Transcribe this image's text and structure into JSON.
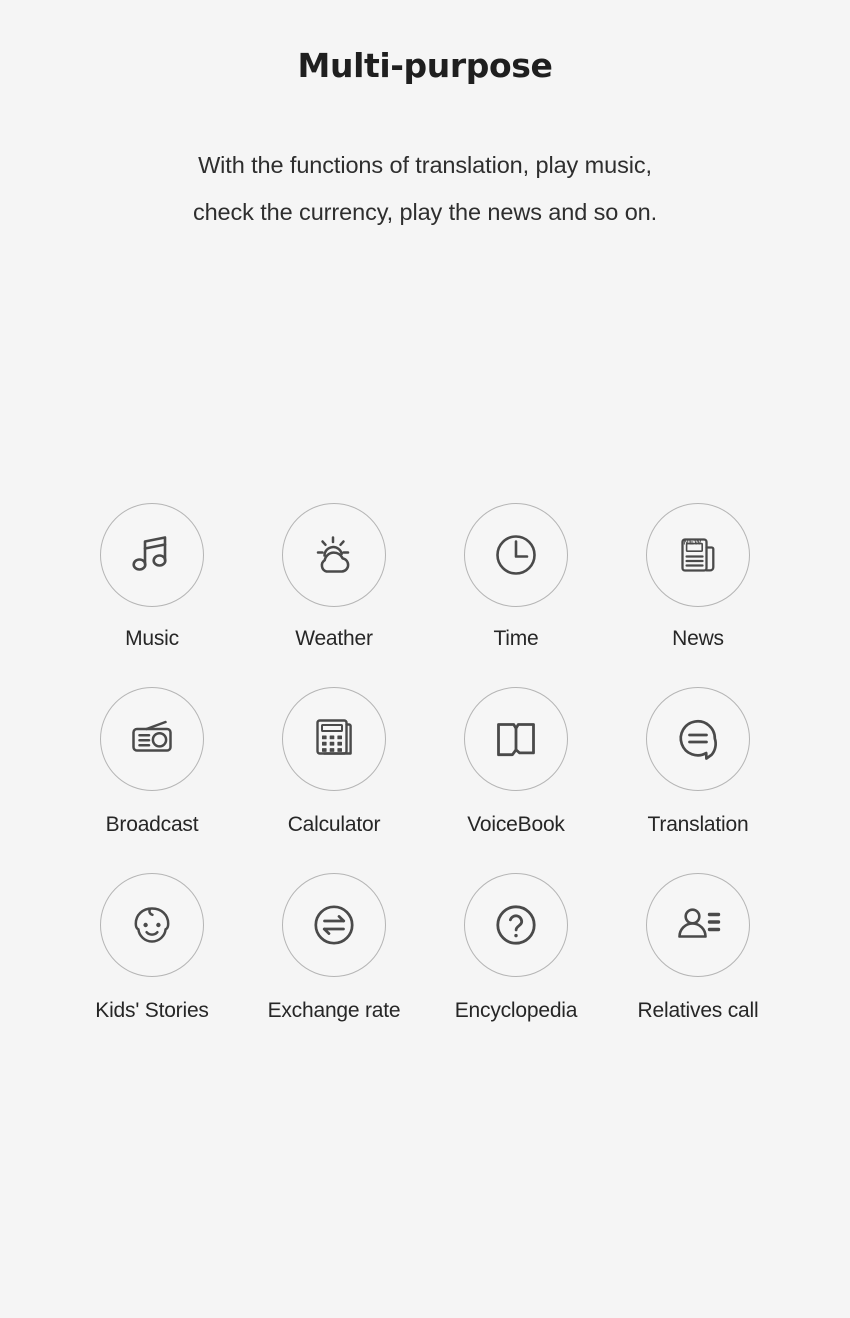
{
  "header": {
    "title": "Multi-purpose",
    "subtitle_lines": [
      "With the functions of translation, play music,",
      "check the currency, play the news and so on."
    ]
  },
  "theme": {
    "background_color": "#f5f5f5",
    "text_color": "#262626",
    "icon_stroke_color": "#4a4a4a",
    "circle_border_color": "#b5b5b5"
  },
  "features": {
    "rows": [
      {
        "items": [
          {
            "label": "Music",
            "icon": "music-note-icon"
          },
          {
            "label": "Weather",
            "icon": "sun-cloud-icon"
          },
          {
            "label": "Time",
            "icon": "clock-icon"
          },
          {
            "label": "News",
            "icon": "newspaper-icon",
            "icon_text": "NEW"
          }
        ]
      },
      {
        "items": [
          {
            "label": "Broadcast",
            "icon": "radio-icon"
          },
          {
            "label": "Calculator",
            "icon": "calculator-icon"
          },
          {
            "label": "VoiceBook",
            "icon": "open-book-icon"
          },
          {
            "label": "Translation",
            "icon": "speech-bubble-equals-icon"
          }
        ]
      },
      {
        "items": [
          {
            "label": "Kids' Stories",
            "icon": "baby-face-icon"
          },
          {
            "label": "Exchange rate",
            "icon": "exchange-arrows-icon"
          },
          {
            "label": "Encyclopedia",
            "icon": "question-mark-circle-icon"
          },
          {
            "label": "Relatives call",
            "icon": "contact-person-icon"
          }
        ]
      }
    ]
  }
}
